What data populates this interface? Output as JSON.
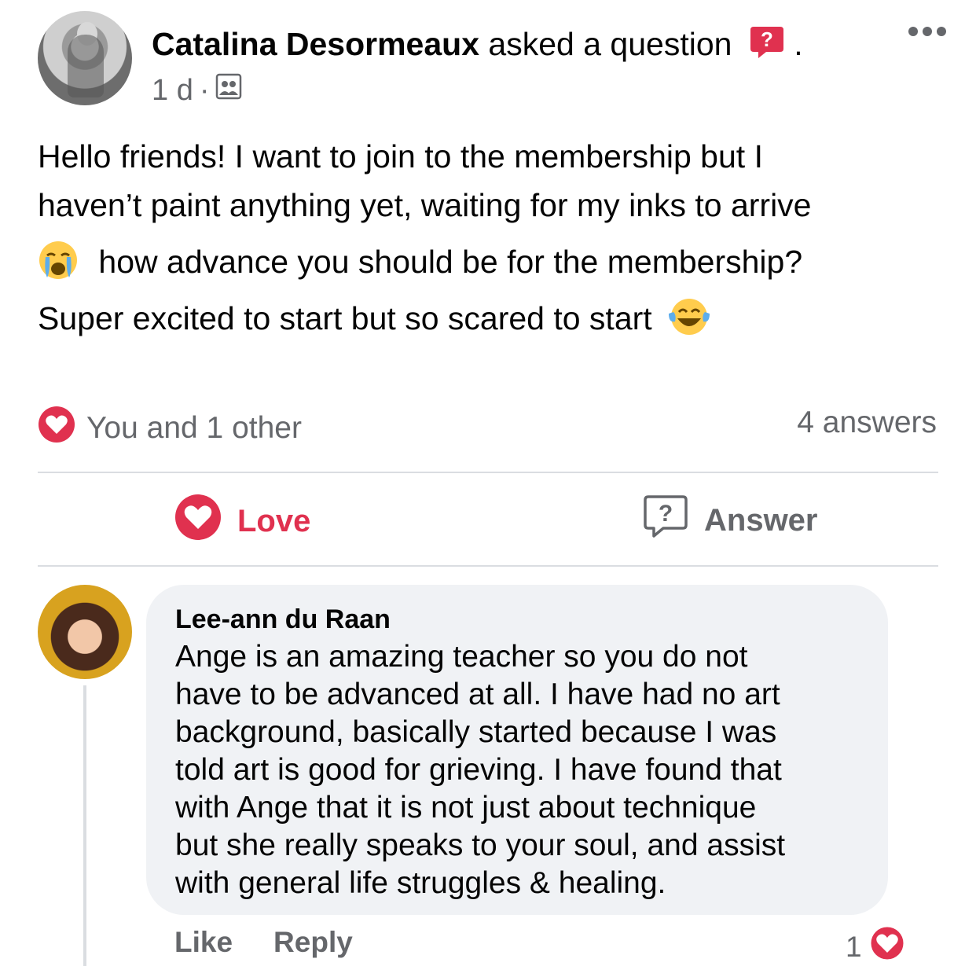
{
  "post": {
    "author_name": "Catalina Desormeaux",
    "action_text": "asked a question",
    "trailing_dot": ".",
    "time": "1 d",
    "separator": "·",
    "audience_icon": "group-icon",
    "lines": [
      "Hello friends! I want to join to the membership but I",
      "haven’t paint anything yet, waiting for my inks to arrive",
      "how advance you should be for the membership?",
      "Super excited to start but so scared to start"
    ]
  },
  "reactions": {
    "summary": "You and 1 other",
    "answers": "4 answers"
  },
  "actions": {
    "love_label": "Love",
    "answer_label": "Answer"
  },
  "comment": {
    "author": "Lee-ann du Raan",
    "lines": [
      "Ange is an amazing teacher so you do not",
      "have to be advanced at all. I have had no art",
      "background, basically started because I was",
      "told art is good for grieving. I have found that",
      "with Ange that it is not just about technique",
      "but she really speaks to your soul, and assist",
      "with general life struggles & healing."
    ],
    "like_label": "Like",
    "reply_label": "Reply",
    "reaction_count": "1"
  },
  "colors": {
    "love_red": "#e0314f",
    "muted": "#65676b",
    "bubble_bg": "#f0f2f5"
  }
}
